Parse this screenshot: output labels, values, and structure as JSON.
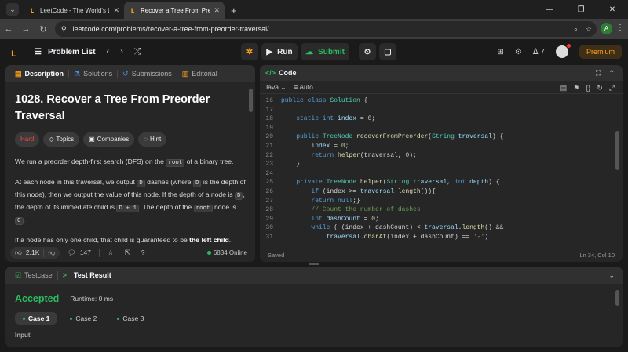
{
  "browser": {
    "tabs": [
      {
        "title": "LeetCode - The World's Leading",
        "favicon": "leetcode-icon"
      },
      {
        "title": "Recover a Tree From Preorder T",
        "favicon": "leetcode-icon"
      }
    ],
    "url": "leetcode.com/problems/recover-a-tree-from-preorder-traversal/",
    "profile_initial": "A"
  },
  "header": {
    "problem_list": "Problem List",
    "run": "Run",
    "submit": "Submit",
    "streak": "7",
    "premium": "Premium"
  },
  "left": {
    "tabs": [
      "Description",
      "Solutions",
      "Submissions",
      "Editorial"
    ],
    "title": "1028. Recover a Tree From Preorder Traversal",
    "tags": [
      "Hard",
      "Topics",
      "Companies",
      "Hint"
    ],
    "p1_a": "We run a preorder depth-first search (DFS) on the ",
    "p1_code": "root",
    "p1_b": " of a binary tree.",
    "p2_a": "At each node in this traversal, we output ",
    "p2_c1": "D",
    "p2_b": " dashes (where ",
    "p2_c2": "D",
    "p2_c": " is the depth of this node), then we output the value of this node.  If the depth of a node is ",
    "p2_c3": "D",
    "p2_d": ", the depth of its immediate child is ",
    "p2_c4": "D + 1",
    "p2_e": ".  The depth of the ",
    "p2_c5": "root",
    "p2_f": " node is ",
    "p2_c6": "0",
    "p2_g": ".",
    "p3_a": "If a node has only one child, that child is guaranteed to be ",
    "p3_b": "the left child",
    "p3_c": ".",
    "likes": "2.1K",
    "comments": "147",
    "online": "6834 Online"
  },
  "code": {
    "title": "Code",
    "language": "Java",
    "mode": "Auto",
    "status": "Saved",
    "position": "Ln 34, Col 10",
    "line_numbers": [
      "16",
      "17",
      "18",
      "19",
      "20",
      "21",
      "22",
      "23",
      "24",
      "25",
      "26",
      "27",
      "28",
      "29",
      "30",
      "31"
    ]
  },
  "bottom": {
    "tabs": [
      "Testcase",
      "Test Result"
    ],
    "verdict": "Accepted",
    "runtime": "Runtime: 0 ms",
    "cases": [
      "Case 1",
      "Case 2",
      "Case 3"
    ],
    "input_label": "Input"
  },
  "colors": {
    "accent": "#ffa116",
    "green": "#2cbb5d",
    "hard": "#ef4743"
  }
}
